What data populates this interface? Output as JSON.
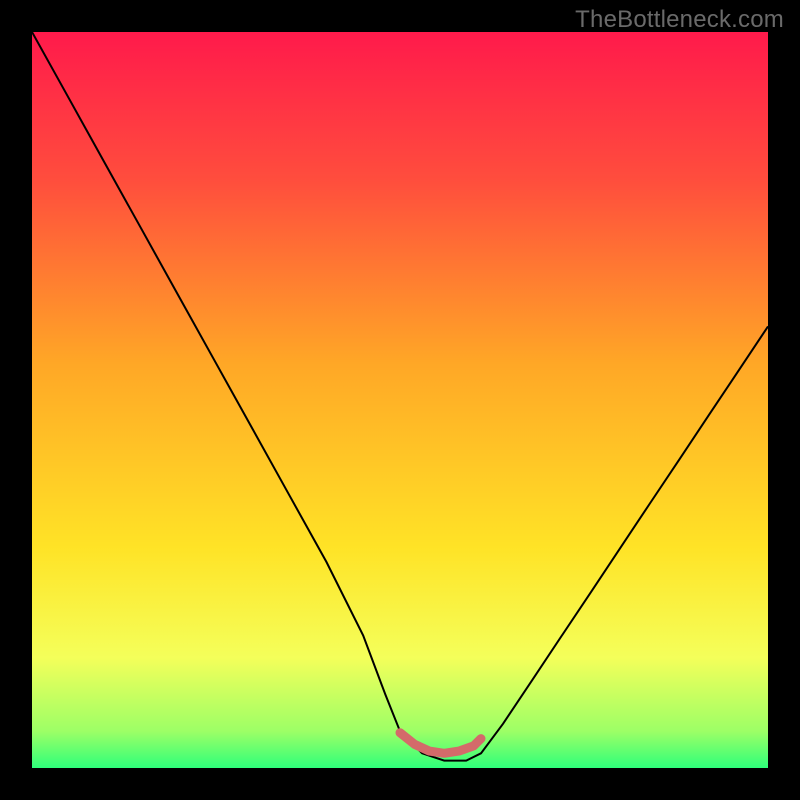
{
  "watermark": "TheBottleneck.com",
  "chart_data": {
    "type": "line",
    "title": "",
    "xlabel": "",
    "ylabel": "",
    "xlim": [
      0,
      100
    ],
    "ylim": [
      0,
      100
    ],
    "background_gradient_stops": [
      {
        "pos": 0.0,
        "color": "#ff1a4b"
      },
      {
        "pos": 0.2,
        "color": "#ff4d3d"
      },
      {
        "pos": 0.45,
        "color": "#ffa726"
      },
      {
        "pos": 0.7,
        "color": "#ffe326"
      },
      {
        "pos": 0.85,
        "color": "#f4ff5a"
      },
      {
        "pos": 0.95,
        "color": "#9dff66"
      },
      {
        "pos": 1.0,
        "color": "#2eff7a"
      }
    ],
    "series": [
      {
        "name": "bottleneck-curve",
        "color": "#000000",
        "width": 2.0,
        "x": [
          0,
          5,
          10,
          15,
          20,
          25,
          30,
          35,
          40,
          45,
          48,
          50,
          53,
          56,
          59,
          61,
          64,
          68,
          72,
          76,
          80,
          84,
          88,
          92,
          96,
          100
        ],
        "values": [
          100,
          91,
          82,
          73,
          64,
          55,
          46,
          37,
          28,
          18,
          10,
          5,
          2,
          1,
          1,
          2,
          6,
          12,
          18,
          24,
          30,
          36,
          42,
          48,
          54,
          60
        ]
      }
    ],
    "highlight_segment": {
      "name": "valley-marker",
      "color": "#d46a6a",
      "width": 9,
      "x": [
        50,
        52,
        54,
        56,
        58,
        60,
        61
      ],
      "values": [
        4.8,
        3.2,
        2.3,
        2.0,
        2.3,
        3.0,
        4.0
      ]
    }
  }
}
